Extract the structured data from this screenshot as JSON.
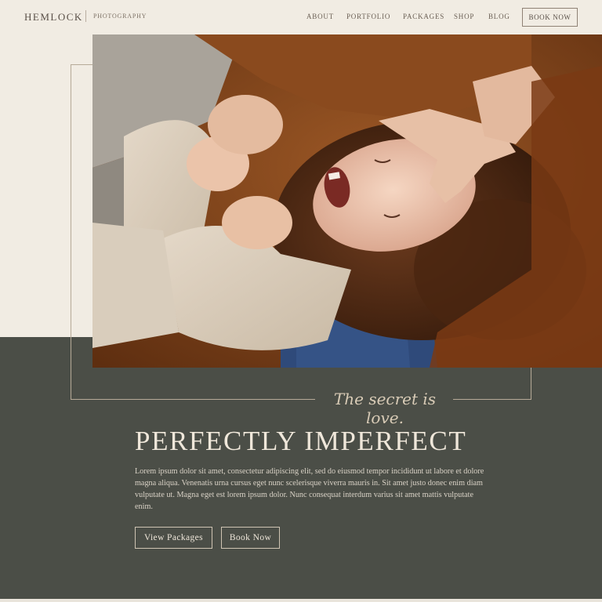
{
  "brand": {
    "name": "HEMLOCK",
    "tagline": "PHOTOGRAPHY"
  },
  "nav": {
    "items": [
      {
        "label": "ABOUT"
      },
      {
        "label": "PORTFOLIO"
      },
      {
        "label": "PACKAGES"
      },
      {
        "label": "SHOP"
      },
      {
        "label": "BLOG"
      }
    ],
    "book_label": "BOOK NOW"
  },
  "hero": {
    "image_icon": "photo-of-parent-and-laughing-child"
  },
  "content": {
    "script_tagline": "The secret is love.",
    "headline": "PERFECTLY IMPERFECT",
    "body": "Lorem ipsum dolor sit amet, consectetur adipiscing elit, sed do eiusmod tempor incididunt ut labore et dolore magna aliqua. Venenatis urna cursus eget nunc scelerisque viverra mauris in. Sit amet justo donec enim diam vulputate ut. Magna eget est lorem ipsum dolor. Nunc consequat interdum varius sit amet mattis vulputate enim.",
    "buttons": {
      "view_packages": "View Packages",
      "book_now": "Book Now"
    }
  },
  "colors": {
    "background": "#f1ece3",
    "dark_band": "#4b4e47",
    "frame": "#b6aa98",
    "accent_rust": "#8a4a1e"
  }
}
